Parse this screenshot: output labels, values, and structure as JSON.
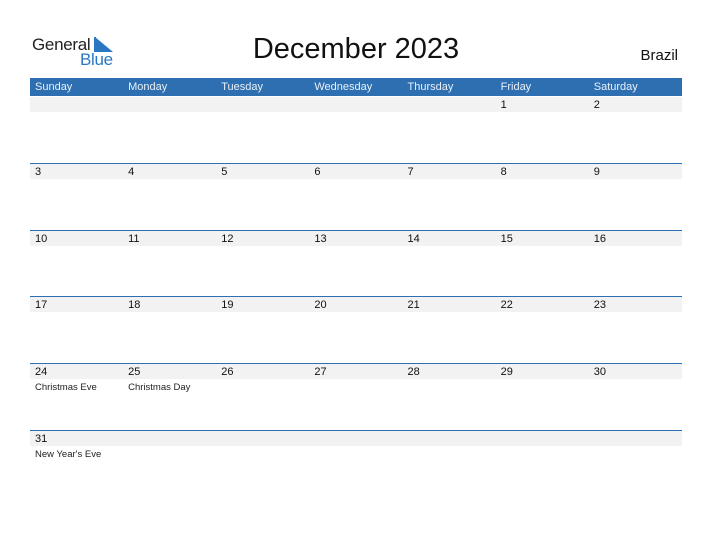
{
  "logo": {
    "line1": "General",
    "line2": "Blue"
  },
  "title": "December 2023",
  "country": "Brazil",
  "colors": {
    "accent": "#2e6fb1",
    "strip": "#f2f2f2",
    "logo_blue": "#2a78c2"
  },
  "weekdays": [
    "Sunday",
    "Monday",
    "Tuesday",
    "Wednesday",
    "Thursday",
    "Friday",
    "Saturday"
  ],
  "weeks": [
    [
      {
        "day": ""
      },
      {
        "day": ""
      },
      {
        "day": ""
      },
      {
        "day": ""
      },
      {
        "day": ""
      },
      {
        "day": "1"
      },
      {
        "day": "2"
      }
    ],
    [
      {
        "day": "3"
      },
      {
        "day": "4"
      },
      {
        "day": "5"
      },
      {
        "day": "6"
      },
      {
        "day": "7"
      },
      {
        "day": "8"
      },
      {
        "day": "9"
      }
    ],
    [
      {
        "day": "10"
      },
      {
        "day": "11"
      },
      {
        "day": "12"
      },
      {
        "day": "13"
      },
      {
        "day": "14"
      },
      {
        "day": "15"
      },
      {
        "day": "16"
      }
    ],
    [
      {
        "day": "17"
      },
      {
        "day": "18"
      },
      {
        "day": "19"
      },
      {
        "day": "20"
      },
      {
        "day": "21"
      },
      {
        "day": "22"
      },
      {
        "day": "23"
      }
    ],
    [
      {
        "day": "24",
        "holiday": "Christmas Eve"
      },
      {
        "day": "25",
        "holiday": "Christmas Day"
      },
      {
        "day": "26"
      },
      {
        "day": "27"
      },
      {
        "day": "28"
      },
      {
        "day": "29"
      },
      {
        "day": "30"
      }
    ],
    [
      {
        "day": "31",
        "holiday": "New Year's Eve"
      },
      {
        "day": ""
      },
      {
        "day": ""
      },
      {
        "day": ""
      },
      {
        "day": ""
      },
      {
        "day": ""
      },
      {
        "day": ""
      }
    ]
  ]
}
